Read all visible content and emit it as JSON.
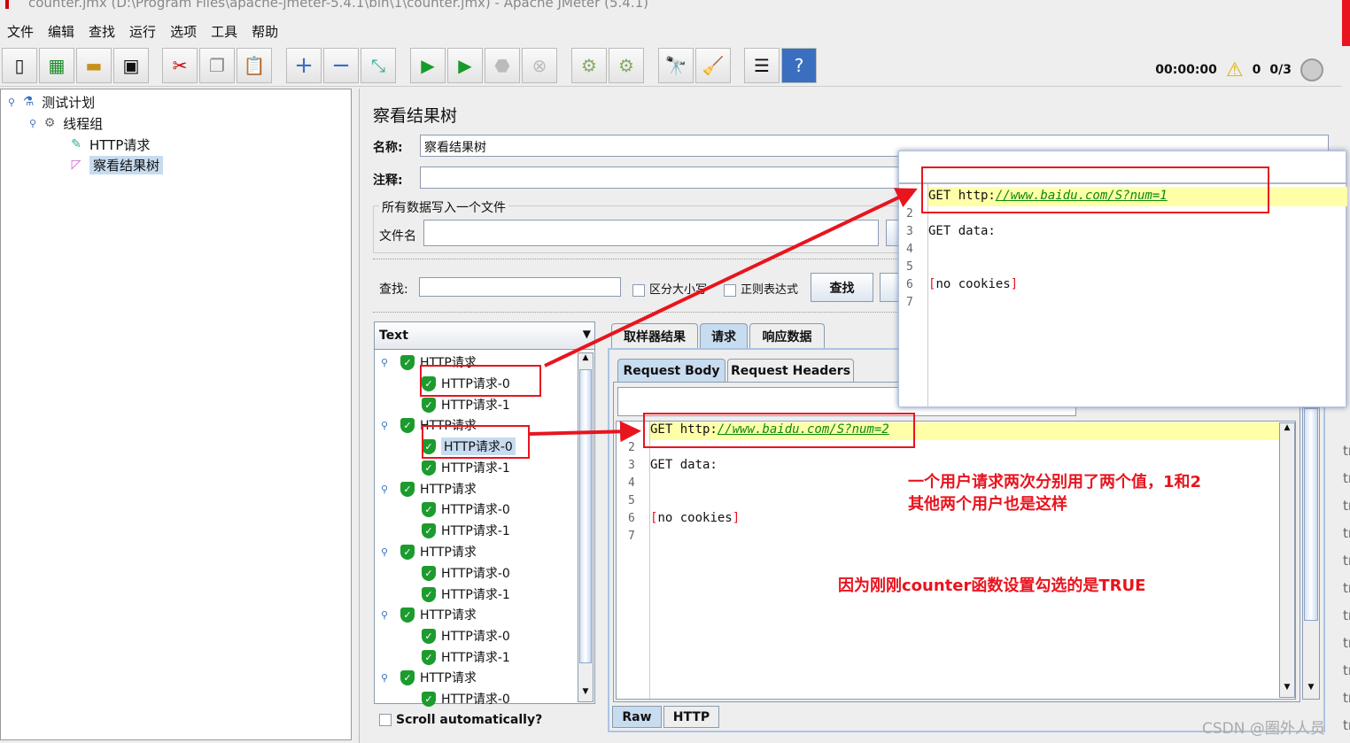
{
  "window": {
    "title": "counter.jmx (D:\\Program Files\\apache-jmeter-5.4.1\\bin\\1\\counter.jmx) - Apache JMeter (5.4.1)"
  },
  "menu": [
    "文件",
    "编辑",
    "查找",
    "运行",
    "选项",
    "工具",
    "帮助"
  ],
  "toolbar": {
    "icons": [
      "new-icon",
      "templates-icon",
      "open-icon",
      "save-icon",
      "cut-icon",
      "copy-icon",
      "paste-icon",
      "expand-icon",
      "collapse-icon",
      "toggle-icon",
      "start-icon",
      "start-no-pause-icon",
      "stop-icon",
      "shutdown-icon",
      "clear-icon",
      "clear-all-icon",
      "search-icon",
      "reset-search-icon",
      "function-helper-icon",
      "help-icon"
    ]
  },
  "status": {
    "time": "00:00:00",
    "warnings": "0",
    "threads": "0/3"
  },
  "test_tree": [
    {
      "label": "测试计划"
    },
    {
      "label": "线程组"
    },
    {
      "label": "HTTP请求"
    },
    {
      "label": "察看结果树"
    }
  ],
  "panel": {
    "title": "察看结果树",
    "name_label": "名称:",
    "name_value": "察看结果树",
    "comment_label": "注释:",
    "file_group": "所有数据写入一个文件",
    "file_label": "文件名",
    "search_label": "查找:",
    "case_label": "区分大小写",
    "regex_label": "正则表达式",
    "search_button": "查找"
  },
  "results": {
    "renderer": "Text",
    "scroll_auto": "Scroll automatically?",
    "items": [
      "HTTP请求",
      "HTTP请求-0",
      "HTTP请求-1",
      "HTTP请求",
      "HTTP请求-0",
      "HTTP请求-1",
      "HTTP请求",
      "HTTP请求-0",
      "HTTP请求-1",
      "HTTP请求",
      "HTTP请求-0",
      "HTTP请求-1",
      "HTTP请求",
      "HTTP请求-0",
      "HTTP请求-1",
      "HTTP请求",
      "HTTP请求-0"
    ],
    "selected_index": 4
  },
  "detail": {
    "tabs": [
      "取样器结果",
      "请求",
      "响应数据"
    ],
    "subtabs": [
      "Request Body",
      "Request Headers"
    ],
    "bottom_tabs": [
      "Raw",
      "HTTP"
    ],
    "lines": {
      "l1_prefix": "GET http:",
      "l1_url": "//www.baidu.com/S?num=2",
      "l3": "GET data:",
      "l6_open": "[",
      "l6_text": "no cookies",
      "l6_close": "]"
    },
    "line_numbers": [
      "2",
      "3",
      "4",
      "5",
      "6",
      "7"
    ]
  },
  "popup": {
    "l1_prefix": "GET http:",
    "l1_url": "//www.baidu.com/S?num=1",
    "l3": "GET data:",
    "l6_open": "[",
    "l6_text": "no cookies",
    "l6_close": "]",
    "line_numbers": [
      "2",
      "3",
      "4",
      "5",
      "6",
      "7"
    ]
  },
  "annotations": {
    "note1": "一个用户请求两次分别用了两个值，1和2",
    "note2": "其他两个用户也是这样",
    "note3": "因为刚刚counter函数设置勾选的是TRUE",
    "color": "#e8141e"
  },
  "watermark": "CSDN @圈外人员",
  "edge_text": "tr"
}
